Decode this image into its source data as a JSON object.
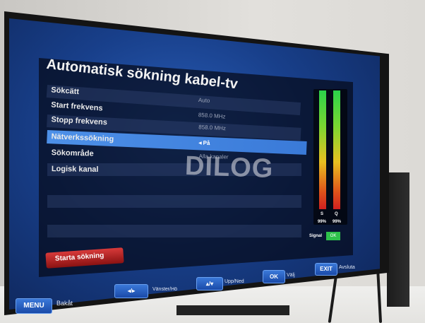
{
  "title": "Automatisk sökning kabel-tv",
  "rows": [
    {
      "label": "Sökсätt",
      "value": "Auto"
    },
    {
      "label": "Start frekvens",
      "value": "858.0 MHz"
    },
    {
      "label": "Stopp frekvens",
      "value": "858.0 MHz"
    },
    {
      "label": "Nätverkssökning",
      "value": "◂ På"
    },
    {
      "label": "Sökområde",
      "value": "Alla kanaler"
    },
    {
      "label": "Logisk kanal",
      "value": ""
    }
  ],
  "start_button": "Starta sökning",
  "watermark": "DILOG",
  "signal": {
    "label": "Signal",
    "status": "OK",
    "meter_labels": [
      "S",
      "Q"
    ],
    "meter_values": [
      "99%",
      "99%"
    ]
  },
  "bottom_bar": {
    "menu_key": "MENU",
    "menu_label": "Bakåt",
    "lr_key": "◂/▸",
    "lr_label": "Vänster/Hö",
    "ud_key": "▴/▾",
    "ud_label": "Upp/Ned",
    "ok_key": "OK",
    "ok_label": "Välj",
    "exit_key": "EXIT",
    "exit_label": "Avsluta"
  }
}
